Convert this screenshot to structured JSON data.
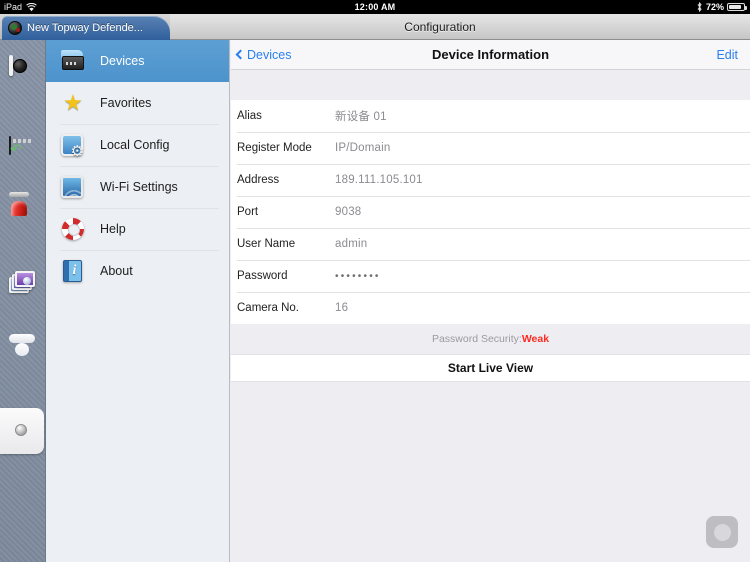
{
  "statusbar": {
    "device": "iPad",
    "wifi_icon": "wifi-icon",
    "time": "12:00 AM",
    "bluetooth_icon": "bluetooth-icon",
    "battery_percent": "72%",
    "battery_icon": "battery-icon"
  },
  "tabbar": {
    "active_tab_title": "New Topway Defende...",
    "favicon": "camera-lens-icon"
  },
  "appbar": {
    "title": "Configuration"
  },
  "rail": {
    "items": [
      {
        "name": "live-view",
        "icon": "live-view-icon",
        "active": false
      },
      {
        "name": "playback",
        "icon": "playback-icon",
        "active": false
      },
      {
        "name": "alarm",
        "icon": "alarm-siren-icon",
        "active": false
      },
      {
        "name": "pictures",
        "icon": "picture-gallery-icon",
        "active": false
      },
      {
        "name": "cloud",
        "icon": "cloud-icon",
        "active": false
      },
      {
        "name": "configuration",
        "icon": "gear-icon",
        "active": true
      }
    ]
  },
  "sidebar": {
    "items": [
      {
        "label": "Devices",
        "icon": "device-box-icon",
        "selected": true
      },
      {
        "label": "Favorites",
        "icon": "star-icon",
        "selected": false
      },
      {
        "label": "Local Config",
        "icon": "gear-screen-icon",
        "selected": false
      },
      {
        "label": "Wi-Fi Settings",
        "icon": "wifi-screen-icon",
        "selected": false
      },
      {
        "label": "Help",
        "icon": "lifebuoy-icon",
        "selected": false
      },
      {
        "label": "About",
        "icon": "info-book-icon",
        "selected": false
      }
    ]
  },
  "detail": {
    "back_label": "Devices",
    "back_icon": "chevron-left-icon",
    "title": "Device Information",
    "edit_label": "Edit",
    "rows": [
      {
        "label": "Alias",
        "value": "新设备 01",
        "masked": false
      },
      {
        "label": "Register Mode",
        "value": "IP/Domain",
        "masked": false
      },
      {
        "label": "Address",
        "value": "189.111.105.101",
        "masked": false
      },
      {
        "label": "Port",
        "value": "9038",
        "masked": false
      },
      {
        "label": "User Name",
        "value": "admin",
        "masked": false
      },
      {
        "label": "Password",
        "value": "••••••••",
        "masked": true
      },
      {
        "label": "Camera No.",
        "value": "16",
        "masked": false
      }
    ],
    "password_security_label": "Password Security:",
    "password_security_level": "Weak",
    "password_security_color": "#ff2a23",
    "live_view_label": "Start Live View"
  },
  "assistive_touch": {
    "icon": "assistive-touch-icon"
  },
  "colors": {
    "accent_blue": "#2a7ff0",
    "selection_blue": "#4d93cc",
    "panel_bg": "#eeeef2",
    "sidebar_bg": "#eceff3",
    "rail_bg": "#8793a5"
  }
}
